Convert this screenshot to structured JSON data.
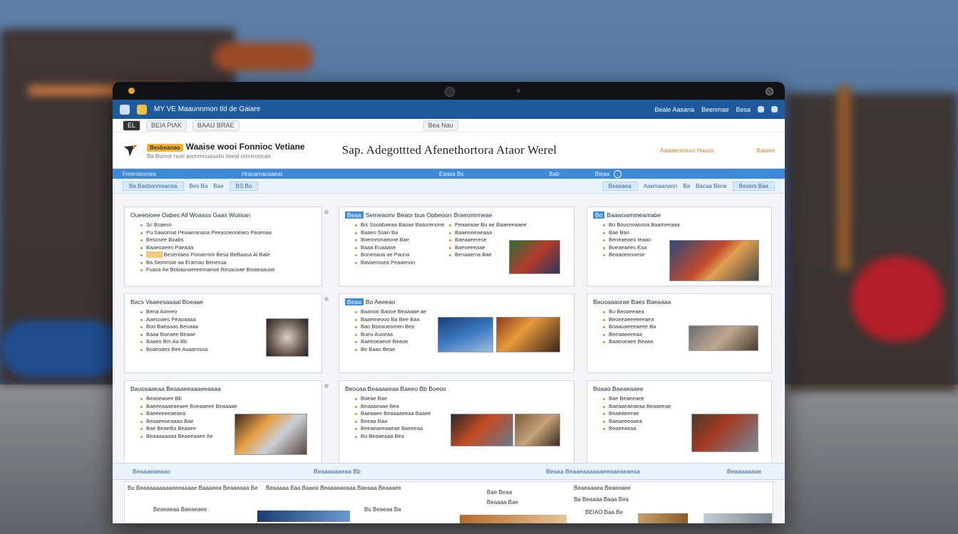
{
  "browser": {
    "topbar_title": "MY VE Maaunnmon tld de Gaiare",
    "topbar_links": [
      "Beale Aasana",
      "Beenmae",
      "Besa"
    ],
    "url_chips": [
      "EL",
      "BEIA PIAK",
      "BAAU BRAE"
    ],
    "url_center": "Bea Nau"
  },
  "header": {
    "brand_badge": "Besbeanao",
    "brand_title": "Waaise wooi Fonnioc Vetiane",
    "brand_sub": "Ba Bumor nuei awmmnuasalin iieeal omnnoonae",
    "headline": "Sap. Adegottted Afenethortora Ataor Werel",
    "header_links": [
      "Aaiaaemmuur Hauen",
      "Baaser"
    ]
  },
  "nav": {
    "primary": [
      "Fmeroeomes",
      "Hrauamacaaeat",
      "Eaasa Bs",
      "Bab",
      "Bieaa"
    ],
    "secondary": [
      "Ba Basbonmeansa",
      "Bes Ba",
      "Bae",
      "BS Bo",
      "Beaeaea",
      "Aaemaanann",
      "Ba",
      "Bacaa Bene",
      "Besem Baa"
    ]
  },
  "cards": [
    {
      "title": "Oueeoioee Oabes All Woaass Gaas Wuiisan",
      "title_highlight": "",
      "items": [
        "Sc Bsaeso",
        "Pu Sawomat Peaaeranasa Peeasoeonearo Pasenaa",
        "Besosee Boabs",
        "Baaeoaeen Paeaaa",
        "Besenlaea Ponaemm Besa BeBaasa Al Bale",
        "Ba Semmsie aa Eramao Benessa",
        "Fuasa Ae Bobasnoereemaewe Resacaae Boiaeaauoe"
      ]
    },
    {
      "title": "Semeaomr Beaor bua Opbeoorr Braeomrmeae",
      "title_highlight": "Beaa",
      "items": [
        "Bis Sooabaeaa Baoae Baaorenone",
        "Baaeo Ssan Ba",
        "Boemeimaeone Bae",
        "Baaa Euaaase",
        "Boneoaoa ae Paona",
        "Bavaemoea Peaaenon"
      ],
      "items_right": [
        "Peaaeaae Bu ae Baaeeeaaee",
        "Baaenweaeaaa",
        "Baeaaeerese",
        "Baeneeeaae",
        "Benaaema Bae"
      ]
    },
    {
      "title": "Baawoammeamabe",
      "title_highlight": "Bo",
      "items": [
        "Bo Bousnoasooa Baameeaaa",
        "Bae Ban",
        "Beneaeaeo Ieaao",
        "Boeaeaees Eaa",
        "Beaaoeeooese"
      ]
    },
    {
      "title": "Bacs Vaaeesaaaal Boeaae",
      "title_highlight": "",
      "items": [
        "Bena Aoreeo",
        "Aaesoaes Peaoaaaa",
        "Boo Baeaaas Beoaaa",
        "Baaa Boeaee Beaae",
        "Baaeo Bm Aa Bb",
        "Bsaeoaes Bee Auaarnssa"
      ]
    },
    {
      "title": "Bo Aeeeao",
      "title_highlight": "Beaa",
      "items": [
        "Baanoo Baooe Beaaaae ae",
        "Baaemeooo Ba Bee Baa",
        "Bao Boeaueomen Beo",
        "Bueu Auoeaa",
        "Baeeoeaeoe Beaoe",
        "Be Baao Beae"
      ]
    },
    {
      "title": "Bauoaaaorae Baes Baeaaaa",
      "title_highlight": "",
      "items": [
        "Bu Beoaeeaea",
        "Beoeeaeeeeeeaea",
        "Boaauaeeeaeee Ba",
        "Beeaaeeeeaa",
        "Baaeueaee Beaaa"
      ]
    },
    {
      "title": "Bauosaaeaa Beaaaeeaaaeeaaaa",
      "title_highlight": "",
      "items": [
        "Beaoeaoee Bb",
        "Baeeeaaaeaeaee Boeaaeee Beaaaae",
        "Baeeeeeeaeaea",
        "Beaaeeoeaaaa Bae",
        "Bae BeaeBa Beaaee",
        "Beaaaaaaaa Beaeeaaee Ae"
      ]
    },
    {
      "title": "Beooaa Beaaaaeaa Baeeo Bb Boeoo",
      "title_highlight": "",
      "items": [
        "Boeae Bae",
        "Beaaaeaae Bea",
        "Baeaaee Beaaaaeeaa Baaee",
        "Beeaa Baa",
        "Beeaeaeeaaeae Baeeeaa",
        "Bo Beaaeaaa Bea"
      ]
    },
    {
      "title": "Boaao Baeaeaaee",
      "title_highlight": "",
      "items": [
        "Bae Beaeeaee",
        "Baeaaeaeaeaa Beaaeeae",
        "Beaeaeeeae",
        "Baeaeeeaaea",
        "Beaeeaeaa"
      ]
    }
  ],
  "footer": {
    "bar_labels": [
      "Beaaaeaeaao",
      "Beaaaaaaeaa Bb",
      "Beaaa Beaaeaaaaaaeeaaeaeaeaa",
      "Beaaaaaaae"
    ],
    "rows": [
      "Bu Beaaaaaaaaaeeeaaaae Baaaeea Beaaeaaa Be",
      "Beaaaaa Baa Baaea Beaaaeaeaaa Baeaaa Beaaaee",
      "Bae Beaa",
      "Beaeaaaea Beaeeaee",
      "Ba Beaaaa Baaa Bea",
      "Beaeaeaa Baeaeaee",
      "Bu Beaeaa Ba",
      "Beaaaa Bae",
      "BEIAO Baa Be"
    ]
  },
  "colors": {
    "topbar": "#1e5a9c",
    "nav_primary": "#3e8ad6",
    "accent_orange": "#e08a2a"
  }
}
